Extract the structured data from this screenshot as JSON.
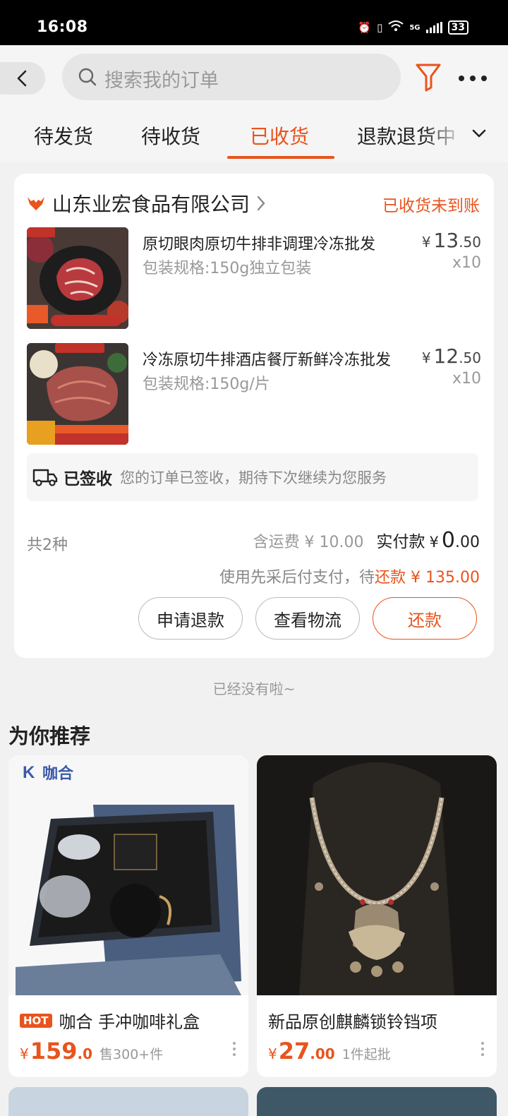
{
  "status_bar": {
    "time": "16:08",
    "battery": "33",
    "network": "5G"
  },
  "header": {
    "search_placeholder": "搜索我的订单"
  },
  "tabs": [
    {
      "label": "待发货",
      "active": false
    },
    {
      "label": "待收货",
      "active": false
    },
    {
      "label": "已收货",
      "active": true
    },
    {
      "label": "退款退货中",
      "active": false
    }
  ],
  "order": {
    "shop_name": "山东业宏食品有限公司",
    "status": "已收货未到账",
    "items": [
      {
        "title": "原切眼肉原切牛排非调理冷冻批发",
        "spec": "包装规格:150g独立包装",
        "price_int": "13",
        "price_dec": ".50",
        "currency": "¥",
        "qty": "x10"
      },
      {
        "title": "冷冻原切牛排酒店餐厅新鲜冷冻批发",
        "spec": "包装规格:150g/片",
        "price_int": "12",
        "price_dec": ".50",
        "currency": "¥",
        "qty": "x10"
      }
    ],
    "notice_strong": "已签收",
    "notice_msg": "您的订单已签收，期待下次继续为您服务",
    "count": "共2种",
    "shipping": "含运费 ¥ 10.00",
    "paid_label": "实付款",
    "paid_currency": "¥",
    "paid_int": "0",
    "paid_dec": ".00",
    "pay_note": "使用先采后付支付，待",
    "pay_due": "还款 ¥ 135.00",
    "buttons": {
      "refund": "申请退款",
      "logistics": "查看物流",
      "repay": "还款"
    }
  },
  "end_text": "已经没有啦~",
  "recommend": {
    "title": "为你推荐",
    "items": [
      {
        "badge": "HOT",
        "brand": "咖合",
        "name": "咖合 手冲咖啡礼盒",
        "currency": "¥",
        "price_int": "159",
        "price_dec": ".0",
        "sold": "售300+件"
      },
      {
        "name": "新品原创麒麟锁铃铛项",
        "currency": "¥",
        "price_int": "27",
        "price_dec": ".00",
        "sold": "1件起批"
      }
    ]
  },
  "colors": {
    "accent": "#e8541d",
    "background": "#f1f1f1"
  }
}
